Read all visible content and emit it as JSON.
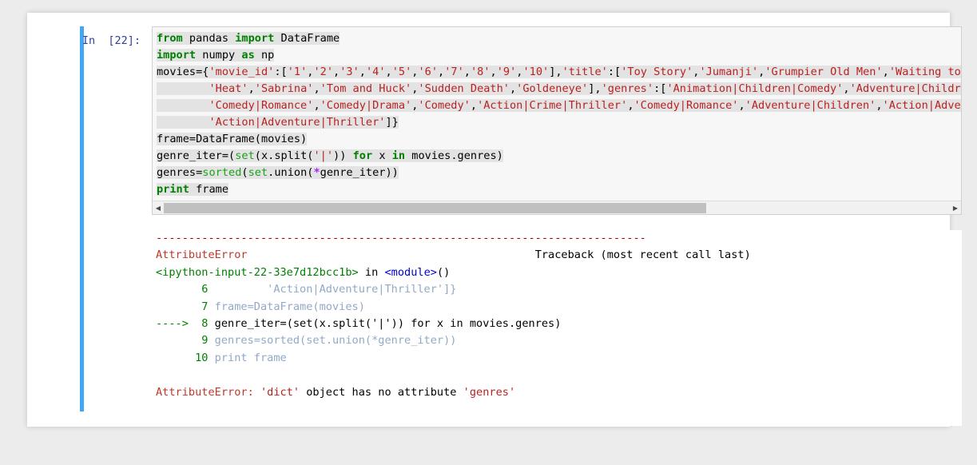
{
  "notebook": {
    "cell": {
      "prompt": "In  [22]:",
      "prompt_number": "22",
      "execution_state": "error"
    },
    "input_code": {
      "lines": [
        [
          {
            "t": "from",
            "c": "kw"
          },
          {
            "t": " pandas ",
            "c": "plain"
          },
          {
            "t": "import",
            "c": "kw"
          },
          {
            "t": " DataFrame",
            "c": "plain"
          }
        ],
        [
          {
            "t": "import",
            "c": "kw"
          },
          {
            "t": " numpy ",
            "c": "plain"
          },
          {
            "t": "as",
            "c": "kw"
          },
          {
            "t": " np",
            "c": "plain"
          }
        ],
        [
          {
            "t": "movies={",
            "c": "plain"
          },
          {
            "t": "'movie_id'",
            "c": "str"
          },
          {
            "t": ":[",
            "c": "plain"
          },
          {
            "t": "'1'",
            "c": "str"
          },
          {
            "t": ",",
            "c": "plain"
          },
          {
            "t": "'2'",
            "c": "str"
          },
          {
            "t": ",",
            "c": "plain"
          },
          {
            "t": "'3'",
            "c": "str"
          },
          {
            "t": ",",
            "c": "plain"
          },
          {
            "t": "'4'",
            "c": "str"
          },
          {
            "t": ",",
            "c": "plain"
          },
          {
            "t": "'5'",
            "c": "str"
          },
          {
            "t": ",",
            "c": "plain"
          },
          {
            "t": "'6'",
            "c": "str"
          },
          {
            "t": ",",
            "c": "plain"
          },
          {
            "t": "'7'",
            "c": "str"
          },
          {
            "t": ",",
            "c": "plain"
          },
          {
            "t": "'8'",
            "c": "str"
          },
          {
            "t": ",",
            "c": "plain"
          },
          {
            "t": "'9'",
            "c": "str"
          },
          {
            "t": ",",
            "c": "plain"
          },
          {
            "t": "'10'",
            "c": "str"
          },
          {
            "t": "],",
            "c": "plain"
          },
          {
            "t": "'title'",
            "c": "str"
          },
          {
            "t": ":[",
            "c": "plain"
          },
          {
            "t": "'Toy Story'",
            "c": "str"
          },
          {
            "t": ",",
            "c": "plain"
          },
          {
            "t": "'Jumanji'",
            "c": "str"
          },
          {
            "t": ",",
            "c": "plain"
          },
          {
            "t": "'Grumpier Old Men'",
            "c": "str"
          },
          {
            "t": ",",
            "c": "plain"
          },
          {
            "t": "'Waiting to Exhale'",
            "c": "str"
          },
          {
            "t": ",",
            "c": "plain"
          }
        ],
        [
          {
            "t": "        ",
            "c": "plain"
          },
          {
            "t": "'Heat'",
            "c": "str"
          },
          {
            "t": ",",
            "c": "plain"
          },
          {
            "t": "'Sabrina'",
            "c": "str"
          },
          {
            "t": ",",
            "c": "plain"
          },
          {
            "t": "'Tom and Huck'",
            "c": "str"
          },
          {
            "t": ",",
            "c": "plain"
          },
          {
            "t": "'Sudden Death'",
            "c": "str"
          },
          {
            "t": ",",
            "c": "plain"
          },
          {
            "t": "'Goldeneye'",
            "c": "str"
          },
          {
            "t": "],",
            "c": "plain"
          },
          {
            "t": "'genres'",
            "c": "str"
          },
          {
            "t": ":[",
            "c": "plain"
          },
          {
            "t": "'Animation|Children|Comedy'",
            "c": "str"
          },
          {
            "t": ",",
            "c": "plain"
          },
          {
            "t": "'Adventure|Children|Fantasy'",
            "c": "str"
          },
          {
            "t": ",",
            "c": "plain"
          }
        ],
        [
          {
            "t": "        ",
            "c": "plain"
          },
          {
            "t": "'Comedy|Romance'",
            "c": "str"
          },
          {
            "t": ",",
            "c": "plain"
          },
          {
            "t": "'Comedy|Drama'",
            "c": "str"
          },
          {
            "t": ",",
            "c": "plain"
          },
          {
            "t": "'Comedy'",
            "c": "str"
          },
          {
            "t": ",",
            "c": "plain"
          },
          {
            "t": "'Action|Crime|Thriller'",
            "c": "str"
          },
          {
            "t": ",",
            "c": "plain"
          },
          {
            "t": "'Comedy|Romance'",
            "c": "str"
          },
          {
            "t": ",",
            "c": "plain"
          },
          {
            "t": "'Adventure|Children'",
            "c": "str"
          },
          {
            "t": ",",
            "c": "plain"
          },
          {
            "t": "'Action|Adventure'",
            "c": "str"
          },
          {
            "t": ",",
            "c": "plain"
          }
        ],
        [
          {
            "t": "        ",
            "c": "plain"
          },
          {
            "t": "'Action|Adventure|Thriller'",
            "c": "str"
          },
          {
            "t": "]}",
            "c": "plain"
          }
        ],
        [
          {
            "t": "frame=DataFrame(movies)",
            "c": "plain"
          }
        ],
        [
          {
            "t": "genre_iter=(",
            "c": "plain"
          },
          {
            "t": "set",
            "c": "bi"
          },
          {
            "t": "(x.split(",
            "c": "plain"
          },
          {
            "t": "'|'",
            "c": "str"
          },
          {
            "t": ")) ",
            "c": "plain"
          },
          {
            "t": "for",
            "c": "kw"
          },
          {
            "t": " x ",
            "c": "plain"
          },
          {
            "t": "in",
            "c": "kw"
          },
          {
            "t": " movies.genres)",
            "c": "plain"
          }
        ],
        [
          {
            "t": "genres=",
            "c": "plain"
          },
          {
            "t": "sorted",
            "c": "bi"
          },
          {
            "t": "(",
            "c": "plain"
          },
          {
            "t": "set",
            "c": "bi"
          },
          {
            "t": ".union(",
            "c": "plain"
          },
          {
            "t": "*",
            "c": "mag"
          },
          {
            "t": "genre_iter))",
            "c": "plain"
          }
        ],
        [
          {
            "t": "print",
            "c": "kw"
          },
          {
            "t": " frame",
            "c": "plain"
          }
        ]
      ]
    },
    "scrollbar": {
      "left_arrow": "◀",
      "right_arrow": "▶",
      "thumb_position_percent": 0,
      "thumb_width_percent": 69
    },
    "output": {
      "separator": "---------------------------------------------------------------------------",
      "error_type": "AttributeError",
      "traceback_header": "Traceback (most recent call last)",
      "frame_location": "<ipython-input-22-33e7d12bcc1b>",
      "frame_in": " in ",
      "frame_scope": "<module>",
      "frame_call": "()",
      "code_context": [
        {
          "arrow": "",
          "lineno": "6",
          "code": "         'Action|Adventure|Thriller']}",
          "current": false
        },
        {
          "arrow": "",
          "lineno": "7",
          "code": " frame=DataFrame(movies)",
          "current": false
        },
        {
          "arrow": "----> ",
          "lineno": "8",
          "code": " genre_iter=(set(x.split('|')) for x in movies.genres)",
          "current": true
        },
        {
          "arrow": "",
          "lineno": "9",
          "code": " genres=sorted(set.union(*genre_iter))",
          "current": false
        },
        {
          "arrow": "",
          "lineno": "10",
          "code": " print frame",
          "current": false
        }
      ],
      "error_message_label": "AttributeError: ",
      "error_message_text": "'dict' object has no attribute 'genres'",
      "error_object": "'dict'",
      "error_detail": " object has no attribute ",
      "error_attr": "'genres'"
    }
  },
  "colors": {
    "selector_bar": "#42a5f5",
    "keyword": "#008000",
    "builtin": "#19a319",
    "string": "#ba2121",
    "magic": "#aa22ff",
    "error": "#a40000",
    "prompt": "#303f9f",
    "dim_context": "#93a8c6",
    "page_bg": "#ececec",
    "code_bg": "#f7f7f7"
  }
}
